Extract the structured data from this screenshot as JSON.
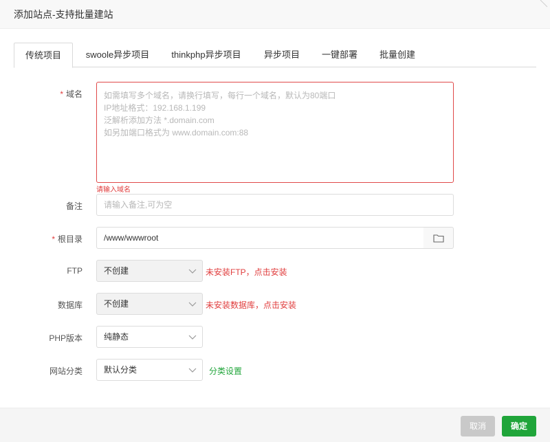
{
  "dialog": {
    "title": "添加站点-支持批量建站"
  },
  "tabs": [
    {
      "label": "传统项目",
      "active": true
    },
    {
      "label": "swoole异步项目",
      "active": false
    },
    {
      "label": "thinkphp异步项目",
      "active": false
    },
    {
      "label": "异步项目",
      "active": false
    },
    {
      "label": "一键部署",
      "active": false
    },
    {
      "label": "批量创建",
      "active": false
    }
  ],
  "form": {
    "domain": {
      "label": "域名",
      "required_mark": "*",
      "placeholder_lines": [
        "如需填写多个域名，请换行填写，每行一个域名，默认为80端口",
        "IP地址格式：192.168.1.199",
        "泛解析添加方法 *.domain.com",
        "如另加端口格式为 www.domain.com:88"
      ],
      "error": "请输入域名"
    },
    "remark": {
      "label": "备注",
      "placeholder": "请输入备注,可为空"
    },
    "root_dir": {
      "label": "根目录",
      "required_mark": "*",
      "value": "/www/wwwroot"
    },
    "ftp": {
      "label": "FTP",
      "selected": "不创建",
      "note": "未安装FTP，点击安装"
    },
    "database": {
      "label": "数据库",
      "selected": "不创建",
      "note": "未安装数据库，点击安装"
    },
    "php_version": {
      "label": "PHP版本",
      "selected": "纯静态"
    },
    "site_category": {
      "label": "网站分类",
      "selected": "默认分类",
      "link": "分类设置"
    }
  },
  "footer": {
    "cancel_label": "取消",
    "confirm_label": "确定"
  },
  "colors": {
    "accent_green": "#20a53a",
    "error_red": "#e03d3d",
    "disabled_gray": "#c9c9c9"
  }
}
